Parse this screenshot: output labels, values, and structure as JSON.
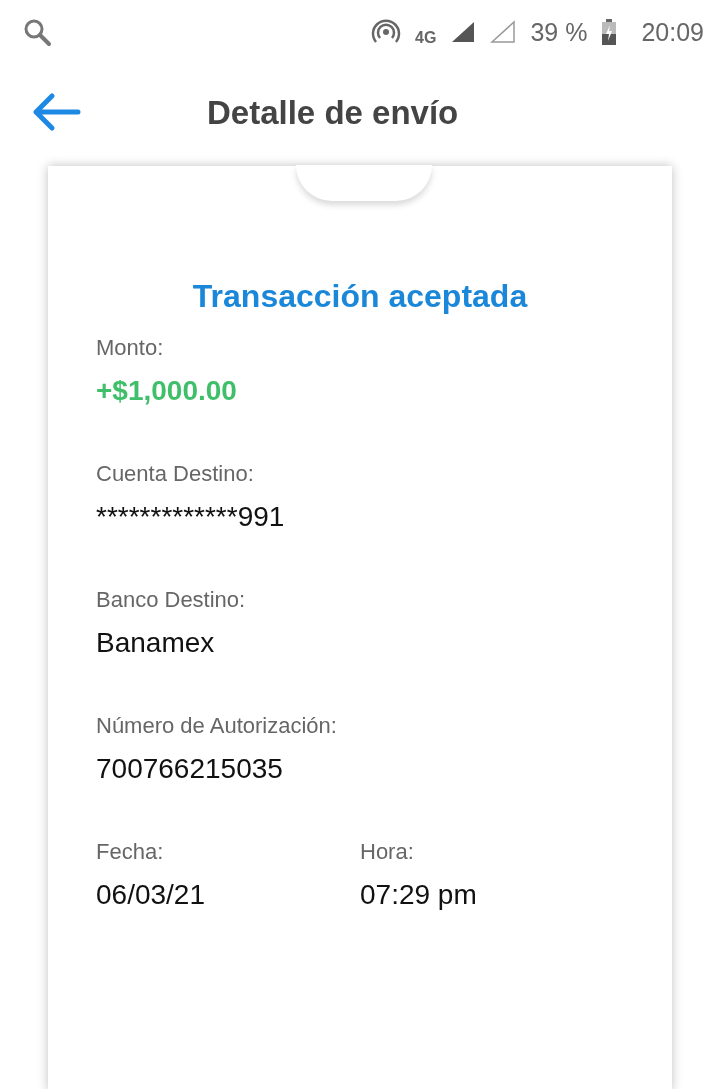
{
  "status_bar": {
    "network": "4G",
    "battery": "39 %",
    "time": "20:09"
  },
  "header": {
    "title": "Detalle de envío"
  },
  "receipt": {
    "status": "Transacción aceptada",
    "fields": [
      {
        "label": "Monto:",
        "value": "+$1,000.00",
        "kind": "amount"
      },
      {
        "label": "Cuenta Destino:",
        "value": "*************991",
        "kind": "plain"
      },
      {
        "label": "Banco Destino:",
        "value": "Banamex",
        "kind": "plain"
      },
      {
        "label": "Número de Autorización:",
        "value": "700766215035",
        "kind": "plain"
      }
    ],
    "footer_fields": [
      {
        "label": "Fecha:",
        "value": "06/03/21"
      },
      {
        "label": "Hora:",
        "value": "07:29 pm"
      }
    ]
  }
}
